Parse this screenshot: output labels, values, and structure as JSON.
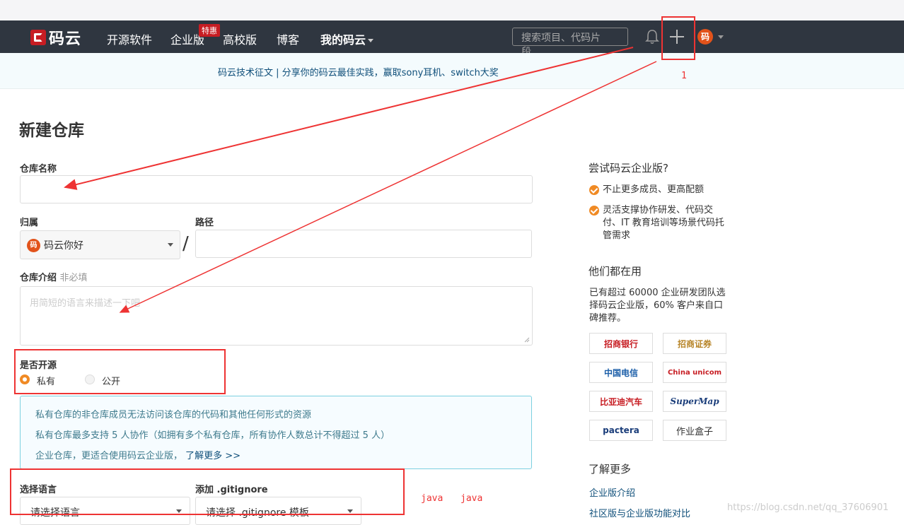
{
  "nav": {
    "logo_text": "码云",
    "links": [
      "开源软件",
      "企业版",
      "高校版",
      "博客",
      "我的码云"
    ],
    "badge": "特惠",
    "search_placeholder": "搜索项目、代码片段...",
    "avatar_text": "码"
  },
  "banner": "码云技术征文 | 分享你的码云最佳实践，赢取sony耳机、switch大奖",
  "form": {
    "title": "新建仓库",
    "name_label": "仓库名称",
    "name_value": "",
    "owner_label": "归属",
    "owner_value": "码云你好",
    "owner_avatar": "码",
    "slash": "/",
    "path_label": "路径",
    "path_value": "",
    "desc_label": "仓库介绍",
    "desc_optional": "非必填",
    "desc_placeholder": "用简短的语言来描述一下吧",
    "open_label": "是否开源",
    "radio_private": "私有",
    "radio_public": "公开",
    "info_lines": [
      "私有仓库的非仓库成员无法访问该仓库的代码和其他任何形式的资源",
      "私有仓库最多支持 5 人协作（如拥有多个私有仓库，所有协作人数总计不得超过 5 人）",
      "企业仓库，更适合使用码云企业版，"
    ],
    "info_link": "了解更多 >>",
    "lang_label": "选择语言",
    "lang_value": "请选择语言",
    "gitignore_label": "添加 .gitignore",
    "gitignore_value": "请选择 .gitignore 模板"
  },
  "sidebar": {
    "try_title": "尝试码云企业版?",
    "bullets": [
      "不止更多成员、更高配额",
      "灵活支撑协作研发、代码交付、IT 教育培训等场景代码托管需求"
    ],
    "users_title": "他们都在用",
    "users_text": "已有超过 60000 企业研发团队选择码云企业版，60% 客户来自口碑推荐。",
    "logos": [
      "招商银行",
      "招商证券",
      "中国电信",
      "China unicom",
      "比亚迪汽车",
      "SuperMap",
      "pactera",
      "作业盒子"
    ],
    "more_title": "了解更多",
    "more_links": [
      "企业版介绍",
      "社区版与企业版功能对比"
    ]
  },
  "annotations": {
    "number": "1",
    "java1": "java",
    "java2": "java"
  },
  "watermark": "https://blog.csdn.net/qq_37606901",
  "colors": {
    "nav_bg": "#2f3640",
    "brand_red": "#c71d23",
    "accent_orange": "#f08a24",
    "annotation_red": "#e33"
  }
}
